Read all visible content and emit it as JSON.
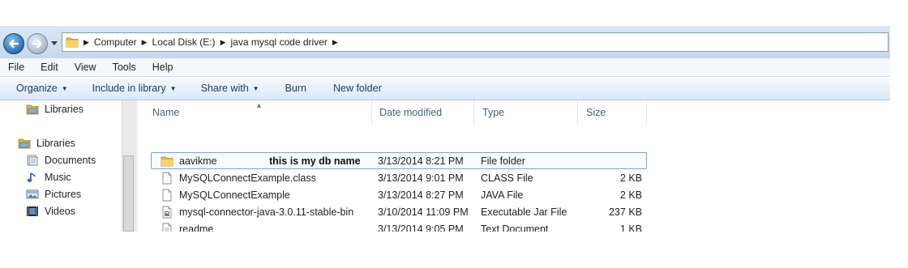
{
  "address": {
    "crumbs": [
      "Computer",
      "Local Disk (E:)",
      "java mysql code driver"
    ]
  },
  "menu": [
    "File",
    "Edit",
    "View",
    "Tools",
    "Help"
  ],
  "commands": [
    {
      "label": "Organize",
      "dropdown": true
    },
    {
      "label": "Include in library",
      "dropdown": true
    },
    {
      "label": "Share with",
      "dropdown": true
    },
    {
      "label": "Burn",
      "dropdown": false
    },
    {
      "label": "New folder",
      "dropdown": false
    }
  ],
  "nav": {
    "top_label": "Libraries",
    "libraries": {
      "label": "Libraries",
      "items": [
        {
          "label": "Documents",
          "icon": "documents-icon"
        },
        {
          "label": "Music",
          "icon": "music-icon"
        },
        {
          "label": "Pictures",
          "icon": "pictures-icon"
        },
        {
          "label": "Videos",
          "icon": "videos-icon"
        }
      ]
    }
  },
  "columns": [
    "Name",
    "Date modified",
    "Type",
    "Size"
  ],
  "files": [
    {
      "name": "aavikme",
      "date": "3/13/2014 8:21 PM",
      "type": "File folder",
      "size": "",
      "icon": "folder-icon"
    },
    {
      "name": "MySQLConnectExample.class",
      "date": "3/13/2014 9:01 PM",
      "type": "CLASS File",
      "size": "2 KB",
      "icon": "file-icon"
    },
    {
      "name": "MySQLConnectExample",
      "date": "3/13/2014 8:27 PM",
      "type": "JAVA File",
      "size": "2 KB",
      "icon": "file-icon"
    },
    {
      "name": "mysql-connector-java-3.0.11-stable-bin",
      "date": "3/10/2014 11:09 PM",
      "type": "Executable Jar File",
      "size": "237 KB",
      "icon": "jar-file-icon"
    },
    {
      "name": "readme",
      "date": "3/13/2014 9:05 PM",
      "type": "Text Document",
      "size": "1 KB",
      "icon": "text-file-icon"
    }
  ],
  "annotation": "this is my db name"
}
